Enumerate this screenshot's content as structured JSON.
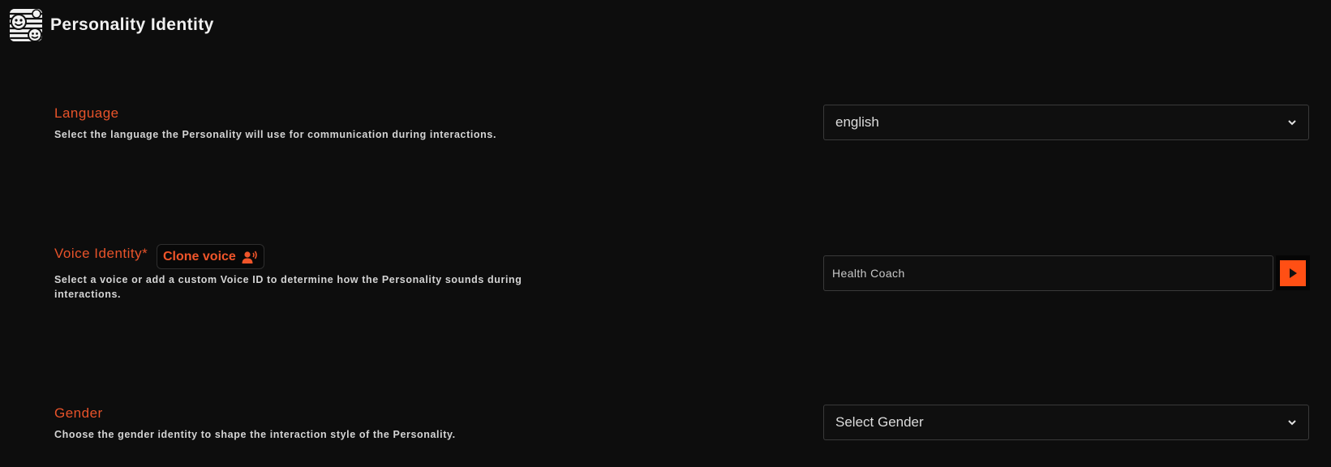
{
  "header": {
    "title": "Personality Identity",
    "logo_icon": "smiley-logo-icon"
  },
  "language": {
    "label": "Language",
    "description": "Select the language the Personality will use for communication during interactions.",
    "selected": "english"
  },
  "voice": {
    "label": "Voice Identity*",
    "clone_button": "Clone voice",
    "description_line1": "Select a voice or add a custom Voice ID to determine how the Personality sounds during",
    "description_line2": "interactions.",
    "value": "Health Coach",
    "play_icon": "play-icon"
  },
  "gender": {
    "label": "Gender",
    "description": "Choose the gender identity to shape the interaction style of the Personality.",
    "placeholder": "Select Gender"
  },
  "colors": {
    "accent": "#e8532a",
    "background": "#0d0d0d",
    "play_button": "#ff4f14"
  }
}
